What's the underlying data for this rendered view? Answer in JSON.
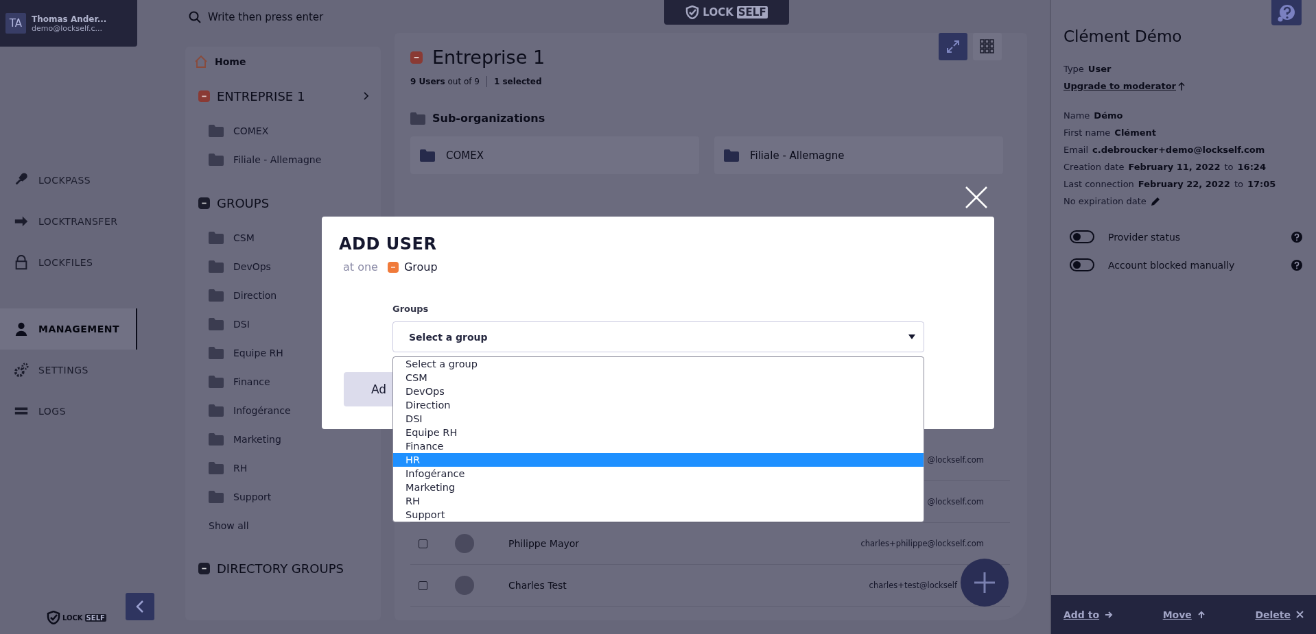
{
  "user": {
    "initials": "TA",
    "name": "Thomas Ander...",
    "email": "demo@lockself.c..."
  },
  "nav_sections": [
    {
      "items": [
        {
          "label": "LOCKPASS",
          "selected": false
        },
        {
          "label": "LOCKTRANSFER",
          "selected": false
        },
        {
          "label": "LOCKFILES",
          "selected": false
        }
      ]
    },
    {
      "items": [
        {
          "label": "MANAGEMENT",
          "selected": true
        },
        {
          "label": "SETTINGS",
          "selected": false
        },
        {
          "label": "LOGS",
          "selected": false
        }
      ]
    }
  ],
  "sidebar_logo": {
    "lock": "LOCK",
    "self": "SELF"
  },
  "search": {
    "placeholder": "Write then press enter"
  },
  "top_logo": {
    "lock": "LOCK",
    "self": "SELF"
  },
  "tree": {
    "home": "Home",
    "organization": {
      "label": "ENTREPRISE 1",
      "children": [
        {
          "label": "COMEX"
        },
        {
          "label": "Filiale - Allemagne"
        }
      ]
    },
    "groups": {
      "label": "GROUPS",
      "children": [
        {
          "label": "CSM"
        },
        {
          "label": "DevOps"
        },
        {
          "label": "Direction"
        },
        {
          "label": "DSI"
        },
        {
          "label": "Equipe RH"
        },
        {
          "label": "Finance"
        },
        {
          "label": "Infogérance"
        },
        {
          "label": "Marketing"
        },
        {
          "label": "RH"
        },
        {
          "label": "Support"
        }
      ],
      "show_all": "Show all"
    },
    "directory_groups": {
      "label": "DIRECTORY GROUPS"
    }
  },
  "main": {
    "title": "Entreprise 1",
    "count": "9 Users",
    "count_total": "out of 9",
    "selection": "1 selected",
    "suborg_heading": "Sub-organizations",
    "suborgs": [
      {
        "label": "COMEX"
      },
      {
        "label": "Filiale - Allemagne"
      }
    ],
    "users": [
      {
        "email": "@lockself.com"
      },
      {
        "email": "@lockself.com"
      },
      {
        "checked": false,
        "name": "Philippe Mayor",
        "email": "charles+philippe@lockself.com"
      },
      {
        "checked": false,
        "name": "Charles Test",
        "email": "charles+test@lockself"
      }
    ]
  },
  "details": {
    "title": "Clément Démo",
    "type_label": "Type",
    "type_value": "User",
    "upgrade": "Upgrade to moderator",
    "fields": [
      {
        "label": "Name",
        "value": "Démo"
      },
      {
        "label": "First name",
        "value": "Clément"
      },
      {
        "label": "Email",
        "value": "c.debroucker+demo@lockself.com"
      },
      {
        "label": "Creation date",
        "value": "February 11, 2022",
        "joiner": "to",
        "time": "16:24"
      },
      {
        "label": "Last connection",
        "value": "February 22, 2022",
        "joiner": "to",
        "time": "17:05"
      }
    ],
    "expiration": "No expiration date",
    "toggles": [
      {
        "label": "Provider status",
        "on": false
      },
      {
        "label": "Account blocked manually",
        "on": false
      }
    ],
    "actions": [
      {
        "label": "Add to",
        "kind": "right"
      },
      {
        "label": "Move",
        "kind": "up"
      },
      {
        "label": "Delete",
        "kind": "close"
      }
    ]
  },
  "modal": {
    "title": "ADD USER",
    "scope_prefix": "at one",
    "scope": "Group",
    "field_label": "Groups",
    "select_value": "Select a group",
    "button": "Ad",
    "options": [
      {
        "label": "Select a group",
        "selected": false
      },
      {
        "label": "CSM",
        "selected": false
      },
      {
        "label": "DevOps",
        "selected": false
      },
      {
        "label": "Direction",
        "selected": false
      },
      {
        "label": "DSI",
        "selected": false
      },
      {
        "label": "Equipe RH",
        "selected": false
      },
      {
        "label": "Finance",
        "selected": false
      },
      {
        "label": "HR",
        "selected": true
      },
      {
        "label": "Infogérance",
        "selected": false
      },
      {
        "label": "Marketing",
        "selected": false
      },
      {
        "label": "RH",
        "selected": false
      },
      {
        "label": "Support",
        "selected": false
      }
    ]
  }
}
